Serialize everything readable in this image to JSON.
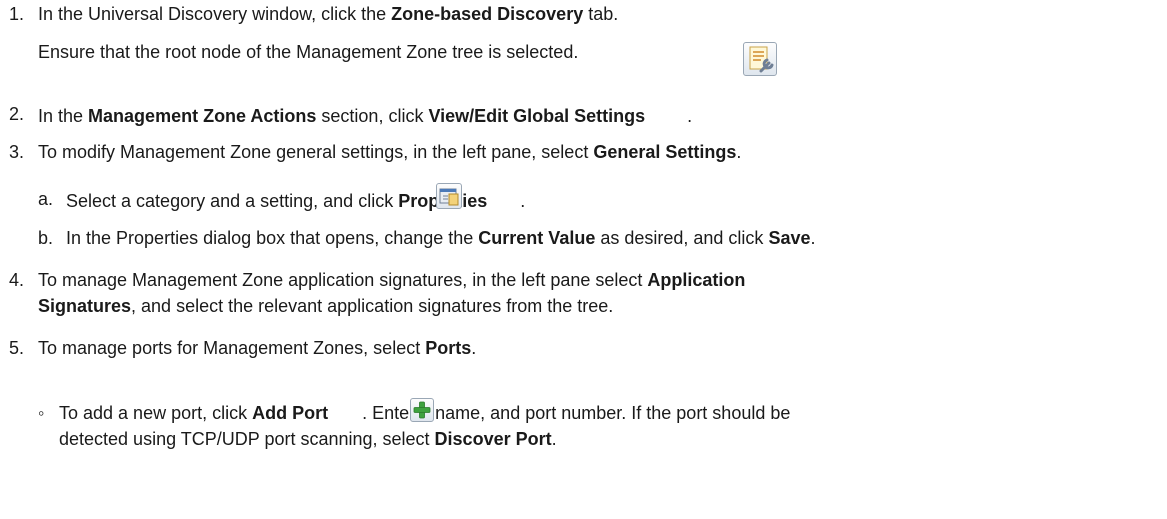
{
  "steps": {
    "s1": {
      "num": "1.",
      "t1": "In the Universal Discovery window, click the ",
      "b1": "Zone-based Discovery",
      "t2": " tab.",
      "sub": "Ensure that the root node of the Management Zone tree is selected."
    },
    "s2": {
      "num": "2.",
      "t1": "In the ",
      "b1": "Management Zone Actions",
      "t2": " section, click ",
      "b2": "View/Edit Global Settings",
      "t3": "."
    },
    "s3": {
      "num": "3.",
      "t1": "To modify Management Zone general settings, in the left pane, select ",
      "b1": "General Settings",
      "t2": "."
    },
    "s3a": {
      "num": "a.",
      "t1": "Select a category and a setting, and click ",
      "b1": "Properties",
      "t2": "."
    },
    "s3b": {
      "num": "b.",
      "t1": "In the Properties dialog box that opens, change the ",
      "b1": "Current Value",
      "t2": " as desired, and click ",
      "b2": "Save",
      "t3": "."
    },
    "s4": {
      "num": "4.",
      "t1": "To manage Management Zone application signatures, in the left pane select ",
      "b1": "Application",
      "b2": "Signatures",
      "t2": ", and select the relevant application signatures from the tree."
    },
    "s5": {
      "num": "5.",
      "t1": "To manage ports for Management Zones, select ",
      "b1": "Ports",
      "t2": "."
    },
    "s5a": {
      "bullet": "◦",
      "t1": "To add a new port, click ",
      "b1": "Add Port",
      "t2": ". Enter a name, and port number. If the port should be",
      "t3": "detected using TCP/UDP port scanning, select ",
      "b2": "Discover Port",
      "t4": "."
    }
  },
  "icons": {
    "view_edit_global_settings": "settings-wrench-icon",
    "properties": "properties-icon",
    "add_port": "add-plus-icon"
  }
}
